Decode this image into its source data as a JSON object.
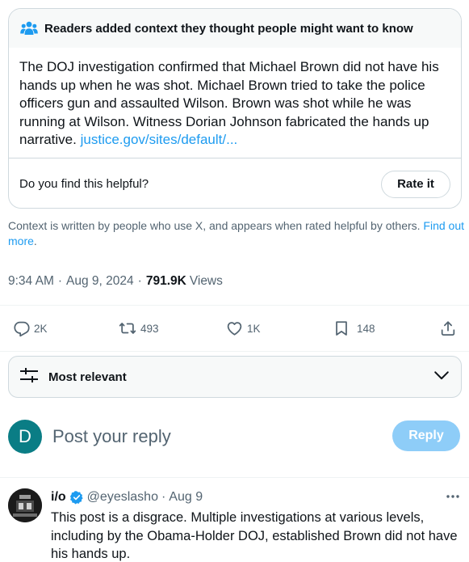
{
  "note": {
    "header": "Readers added context they thought people might want to know",
    "body": "The DOJ investigation confirmed that Michael Brown did not have his hands up when he was shot. Michael Brown tried to take the police officers gun and assaulted Wilson. Brown was shot while he was running at Wilson. Witness Dorian Johnson fabricated the hands up narrative.",
    "link": "justice.gov/sites/default/...",
    "question": "Do you find this helpful?",
    "rate_button": "Rate it"
  },
  "context": {
    "text": "Context is written by people who use X, and appears when rated helpful by others.",
    "link": "Find out more",
    "end": "."
  },
  "meta": {
    "time": "9:34 AM",
    "sep": "·",
    "date": "Aug 9, 2024",
    "views_count": "791.9K",
    "views_label": "Views"
  },
  "actions": {
    "replies": "2K",
    "reposts": "493",
    "likes": "1K",
    "bookmarks": "148"
  },
  "sort": {
    "label": "Most relevant"
  },
  "compose": {
    "avatar_letter": "D",
    "placeholder": "Post your reply",
    "reply_button": "Reply",
    "avatar_color": "#0a7d85"
  },
  "reply": {
    "name": "i/o",
    "handle": "@eyeslasho",
    "sep": "·",
    "date": "Aug 9",
    "text": "This post is a disgrace. Multiple investigations at various levels, including by the Obama-Holder DOJ, established Brown did not have his hands up."
  },
  "colors": {
    "accent": "#1d9bf0",
    "muted": "#536471",
    "border": "#cfd9de",
    "reply_button_disabled": "#8ecdf8"
  }
}
